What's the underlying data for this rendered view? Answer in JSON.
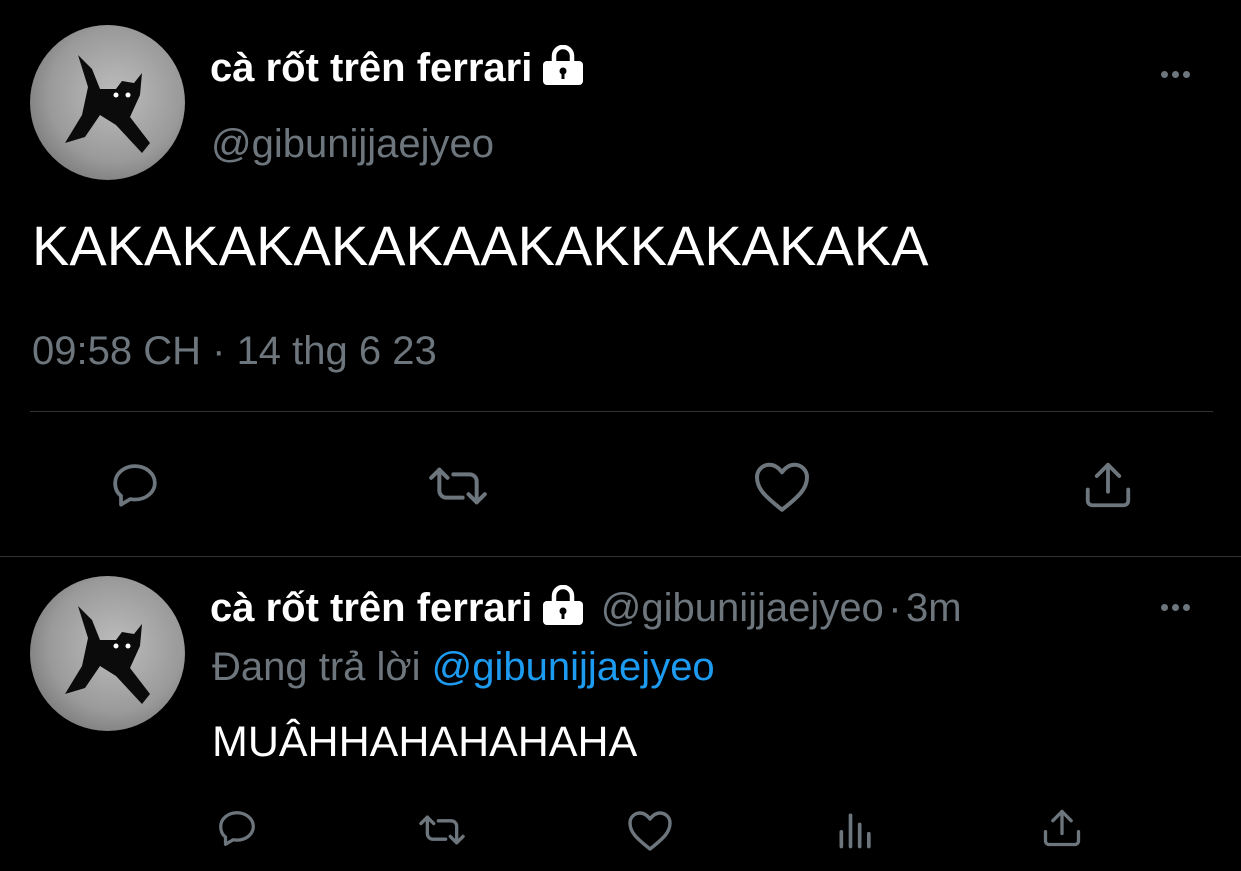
{
  "main_tweet": {
    "display_name": "cà rốt trên ferrari",
    "handle": "@gibunijjaejyeo",
    "text": "KAKAKAKAKAKAAKAKKAKAKAKA",
    "time": "09:58 CH",
    "separator": "·",
    "date": "14 thg 6 23"
  },
  "reply_tweet": {
    "display_name": "cà rốt trên ferrari",
    "handle": "@gibunijjaejyeo",
    "separator": "·",
    "age": "3m",
    "replying_prefix": "Đang trả lời",
    "replying_to": "@gibunijjaejyeo",
    "text": "MUÂHHAHAHAHAHA"
  },
  "icons": {
    "lock": "lock-icon",
    "more": "more-icon",
    "reply": "reply-icon",
    "retweet": "retweet-icon",
    "like": "like-icon",
    "share": "share-icon",
    "views": "views-icon"
  },
  "colors": {
    "background": "#000000",
    "text": "#ffffff",
    "muted": "#6e767d",
    "link": "#1d9bf0",
    "divider": "#2f3336"
  }
}
